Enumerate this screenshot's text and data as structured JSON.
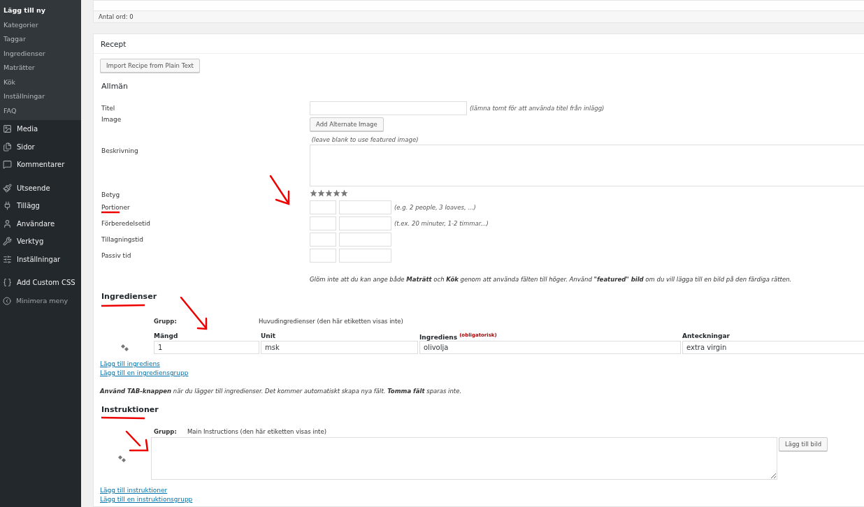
{
  "sidebar": {
    "submenu": [
      {
        "label": "Lägg till ny",
        "selected": true
      },
      {
        "label": "Kategorier",
        "selected": false
      },
      {
        "label": "Taggar",
        "selected": false
      },
      {
        "label": "Ingredienser",
        "selected": false
      },
      {
        "label": "Maträtter",
        "selected": false
      },
      {
        "label": "Kök",
        "selected": false
      },
      {
        "label": "Inställningar",
        "selected": false
      },
      {
        "label": "FAQ",
        "selected": false
      }
    ],
    "menu_groups": [
      [
        "Media",
        "Sidor",
        "Kommentarer"
      ],
      [
        "Utseende",
        "Tillägg",
        "Användare",
        "Verktyg",
        "Inställningar"
      ],
      [
        "Add Custom CSS"
      ]
    ],
    "collapse": "Minimera meny"
  },
  "word_count": "Antal ord: 0",
  "recipe": {
    "title": "Recept",
    "import_button": "Import Recipe from Plain Text",
    "general": {
      "heading": "Allmän",
      "title_field": {
        "label": "Titel",
        "hint": "(lämna tomt för att använda titel från inlägg)"
      },
      "image": {
        "label": "Image",
        "button": "Add Alternate Image",
        "hint": "(leave blank to use featured image)"
      },
      "description": {
        "label": "Beskrivning"
      },
      "rating": {
        "label": "Betyg",
        "stars": 5
      },
      "amount_rows": [
        {
          "label": "Portioner",
          "hint": "(e.g. 2 people, 3 loaves, ...)"
        },
        {
          "label": "Förberedelsetid",
          "hint": "(t.ex. 20 minuter, 1-2 timmar...)"
        },
        {
          "label": "Tillagningstid"
        },
        {
          "label": "Passiv tid"
        }
      ],
      "note": "Glöm inte att du kan ange både **Maträtt** och **Kök** genom att använda fälten till höger. Använd **\"featured\" bild** om du vill lägga till en bild på den färdiga rätten."
    },
    "ingredients": {
      "heading": "Ingredienser",
      "group_label": "Grupp:",
      "group_name": "Huvudingredienser (den här etiketten visas inte)",
      "columns": [
        {
          "label": "Mängd"
        },
        {
          "label": "Unit"
        },
        {
          "label": "Ingrediens",
          "badge": "(obligatorisk)"
        },
        {
          "label": "Anteckningar"
        }
      ],
      "row": [
        "1",
        "msk",
        "olivolja",
        "extra virgin"
      ],
      "links": [
        "Lägg till ingrediens",
        "Lägg till en ingrediensgrupp"
      ],
      "tip": "**Använd TAB-knappen** när du lägger till ingredienser. Det kommer automatiskt skapa nya fält. **Tomma fält** sparas inte."
    },
    "instructions": {
      "heading": "Instruktioner",
      "group_label": "Grupp:",
      "group_name": "Main Instructions (den här etiketten visas inte)",
      "add_image_button": "Lägg till bild",
      "links": [
        "Lägg till instruktioner",
        "Lägg till en instruktionsgrupp"
      ]
    }
  }
}
